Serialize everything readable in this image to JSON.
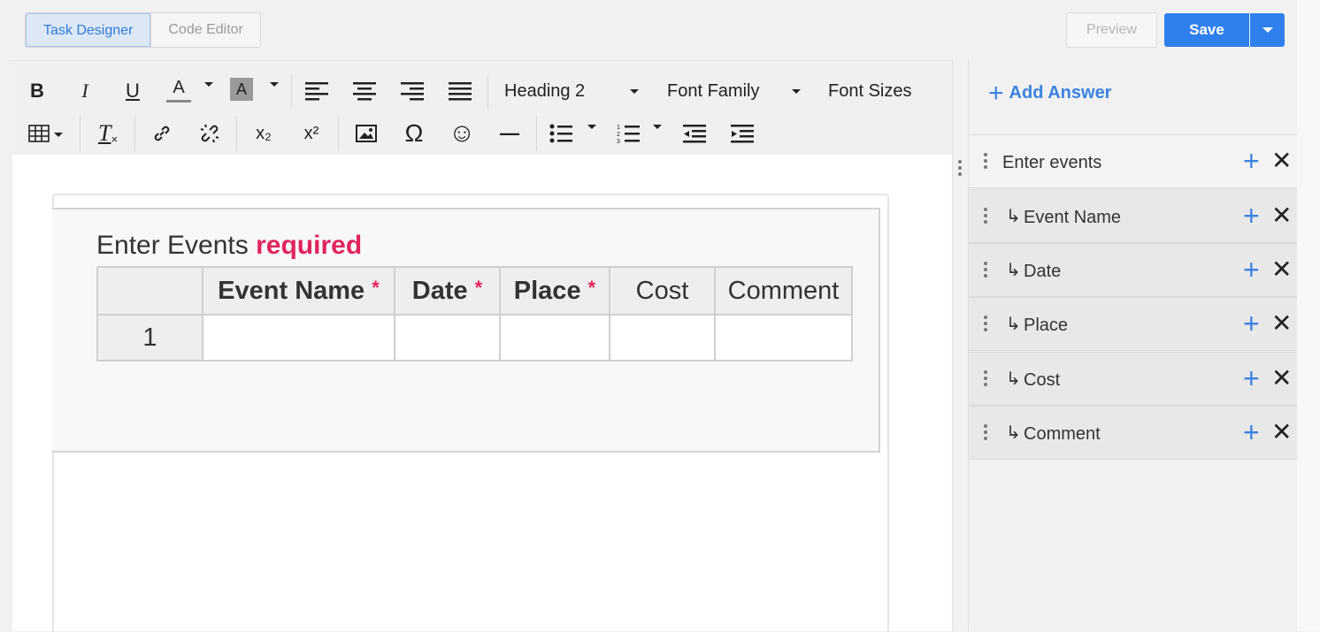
{
  "header": {
    "tabs": [
      {
        "label": "Task Designer",
        "active": true
      },
      {
        "label": "Code Editor",
        "active": false
      }
    ],
    "preview_label": "Preview",
    "save_label": "Save"
  },
  "toolbar": {
    "bold": "B",
    "italic": "I",
    "underline": "U",
    "font_color": "A",
    "bg_color": "A",
    "heading_select": "Heading 2",
    "font_family_select": "Font Family",
    "font_sizes_select": "Font Sizes",
    "omega": "Ω",
    "emoji": "☺",
    "hr": "—",
    "clear_format": "T",
    "subscript": "x₂",
    "superscript": "x²"
  },
  "form": {
    "title": "Enter Events",
    "required_text": "required",
    "columns": [
      {
        "label": "Event Name",
        "required": true
      },
      {
        "label": "Date",
        "required": true
      },
      {
        "label": "Place",
        "required": true
      },
      {
        "label": "Cost",
        "required": false
      },
      {
        "label": "Comment",
        "required": false
      }
    ],
    "rows": [
      {
        "index": "1"
      }
    ],
    "required_mark": "*"
  },
  "panel": {
    "add_answer_label": "Add Answer",
    "items": [
      {
        "label": "Enter events",
        "child": false
      },
      {
        "label": "Event Name",
        "child": true
      },
      {
        "label": "Date",
        "child": true
      },
      {
        "label": "Place",
        "child": true
      },
      {
        "label": "Cost",
        "child": true
      },
      {
        "label": "Comment",
        "child": true
      }
    ],
    "child_arrow": "↳",
    "plus": "+",
    "close": "✕"
  },
  "colors": {
    "accent": "#2f80ed",
    "required": "#e0245e",
    "link": "#3b82e0"
  }
}
